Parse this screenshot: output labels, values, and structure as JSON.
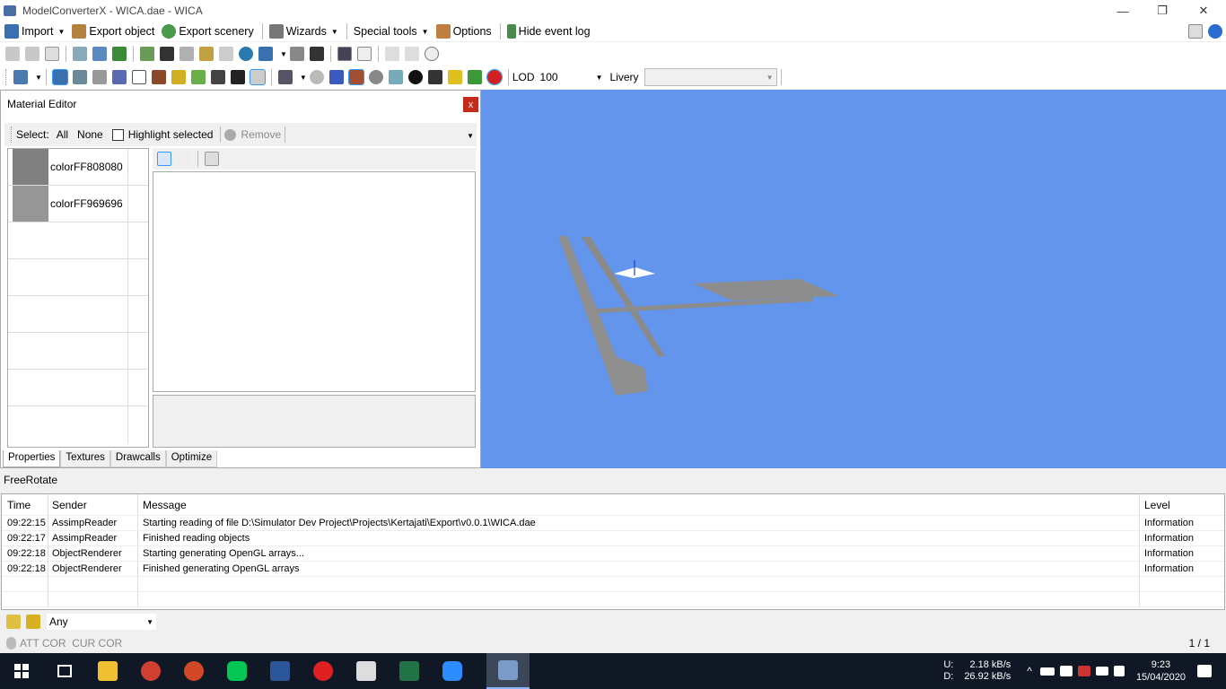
{
  "window": {
    "title": "ModelConverterX - WICA.dae - WICA"
  },
  "menu": {
    "import": "Import",
    "export_object": "Export object",
    "export_scenery": "Export scenery",
    "wizards": "Wizards",
    "special_tools": "Special tools",
    "options": "Options",
    "hide_event_log": "Hide event log"
  },
  "toolbar3": {
    "lod_label": "LOD",
    "lod_value": "100",
    "livery_label": "Livery",
    "livery_value": ""
  },
  "material_editor": {
    "title": "Material Editor",
    "close": "x",
    "select_label": "Select:",
    "select_all": "All",
    "select_none": "None",
    "highlight_selected": "Highlight selected",
    "remove": "Remove",
    "materials": [
      {
        "name": "colorFF808080",
        "color": "#808080"
      },
      {
        "name": "colorFF969696",
        "color": "#969696"
      }
    ],
    "tabs": [
      "Properties",
      "Textures",
      "Drawcalls",
      "Optimize"
    ]
  },
  "viewport": {
    "background": "#6495ed",
    "mode": "FreeRotate"
  },
  "event_log": {
    "columns": [
      "Time",
      "Sender",
      "Message",
      "Level"
    ],
    "rows": [
      {
        "time": "09:22:15",
        "sender": "AssimpReader",
        "message": "Starting reading of file D:\\Simulator Dev Project\\Projects\\Kertajati\\Export\\v0.0.1\\WICA.dae",
        "level": "Information"
      },
      {
        "time": "09:22:17",
        "sender": "AssimpReader",
        "message": "Finished reading objects",
        "level": "Information"
      },
      {
        "time": "09:22:18",
        "sender": "ObjectRenderer",
        "message": "Starting generating OpenGL arrays...",
        "level": "Information"
      },
      {
        "time": "09:22:18",
        "sender": "ObjectRenderer",
        "message": "Finished generating OpenGL arrays",
        "level": "Information"
      }
    ],
    "filter_value": "Any"
  },
  "statusbar": {
    "left": "ATT COR  CUR COR",
    "right": "1 / 1"
  },
  "taskbar": {
    "net_up_label": "U:",
    "net_down_label": "D:",
    "net_up": "2.18 kB/s",
    "net_down": "26.92 kB/s",
    "time": "9:23",
    "date": "15/04/2020"
  }
}
